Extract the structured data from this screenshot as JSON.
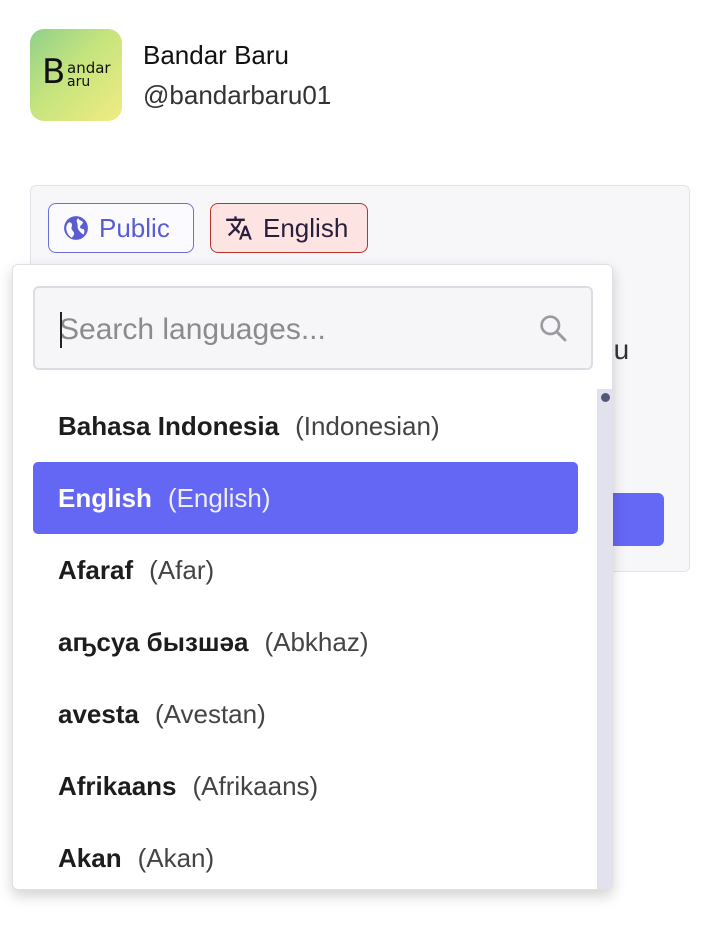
{
  "profile": {
    "avatar_letter": "B",
    "avatar_text_line1": "andar",
    "avatar_text_line2": "aru",
    "display_name": "Bandar Baru",
    "handle": "@bandarbaru01"
  },
  "composer": {
    "visibility_label": "Public",
    "language_label": "English",
    "partial_text": "nu"
  },
  "language_dropdown": {
    "search_placeholder": "Search languages...",
    "search_value": "",
    "items": [
      {
        "native": "Bahasa Indonesia",
        "english": "(Indonesian)",
        "selected": false
      },
      {
        "native": "English",
        "english": "(English)",
        "selected": true
      },
      {
        "native": "Afaraf",
        "english": "(Afar)",
        "selected": false
      },
      {
        "native": "аҧсуа бызшәа",
        "english": "(Abkhaz)",
        "selected": false
      },
      {
        "native": "avesta",
        "english": "(Avestan)",
        "selected": false
      },
      {
        "native": "Afrikaans",
        "english": "(Afrikaans)",
        "selected": false
      },
      {
        "native": "Akan",
        "english": "(Akan)",
        "selected": false
      }
    ]
  },
  "colors": {
    "accent": "#6466f4",
    "public_chip": "#5a5dcf",
    "language_chip_border": "#b8332e",
    "language_chip_bg": "#fde3e2"
  },
  "icons": {
    "visibility": "globe-icon",
    "language": "translate-icon",
    "search": "search-icon"
  }
}
